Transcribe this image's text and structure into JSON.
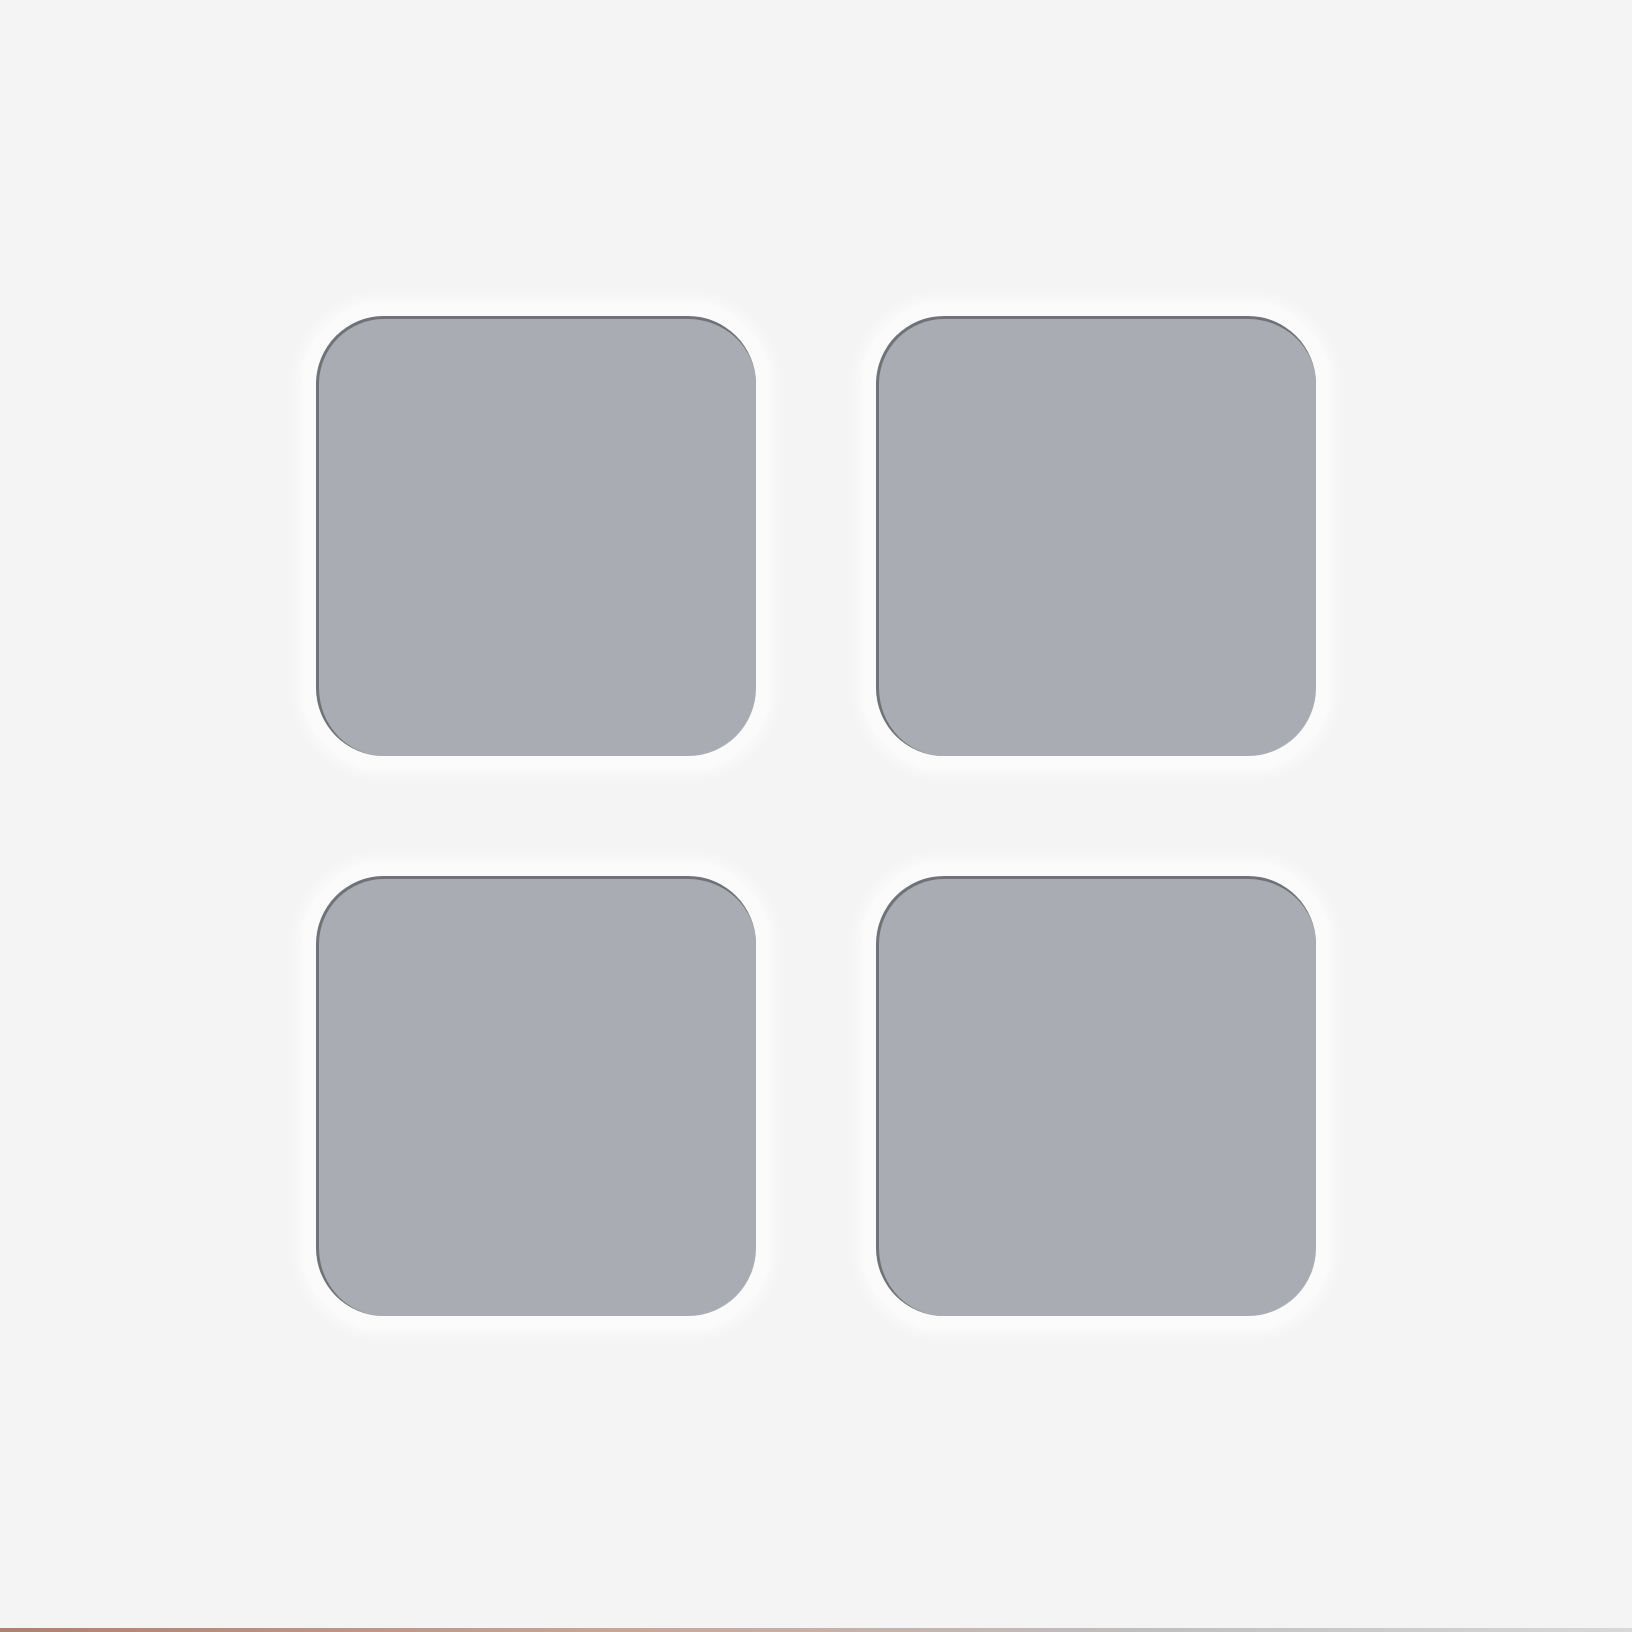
{
  "icon": {
    "name": "app-grid-icon",
    "tile_color": "#a9acb3",
    "tile_outline_color": "#6f7277",
    "background_color": "#f4f4f4",
    "tiles": [
      {
        "name": "tile-top-left"
      },
      {
        "name": "tile-top-right"
      },
      {
        "name": "tile-bottom-left"
      },
      {
        "name": "tile-bottom-right"
      }
    ]
  }
}
